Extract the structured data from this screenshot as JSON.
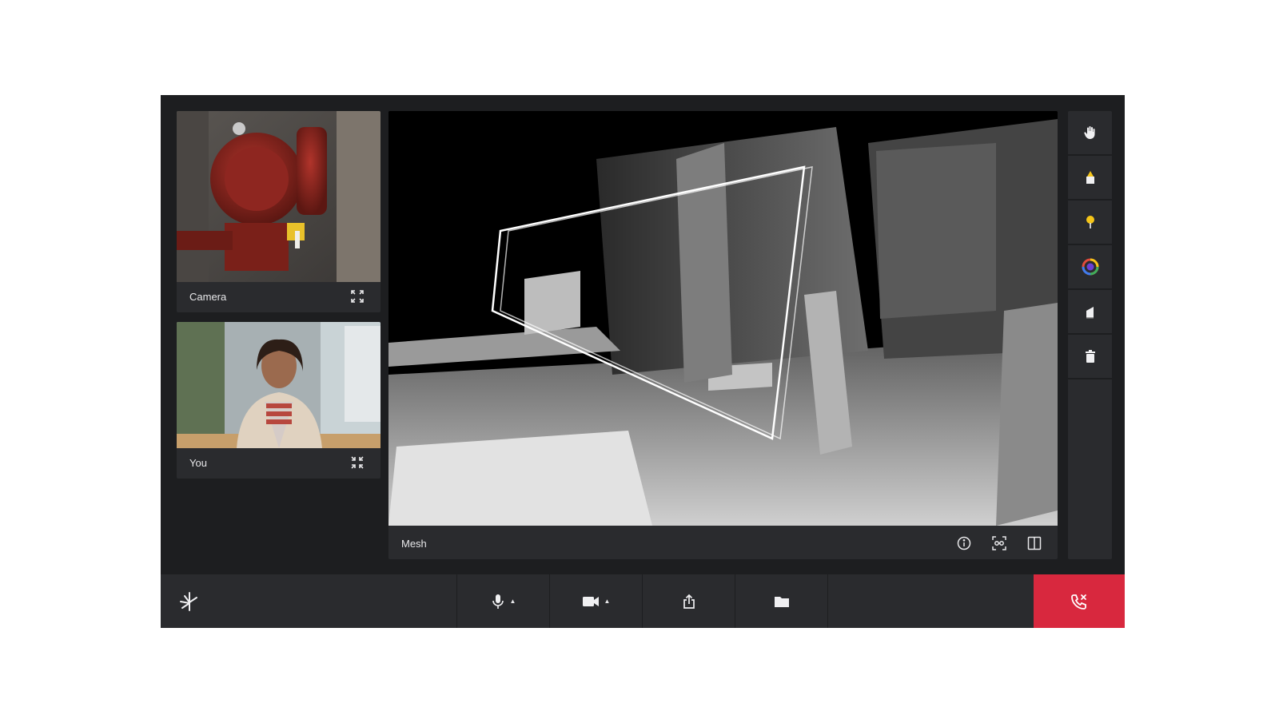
{
  "tiles": {
    "camera": {
      "label": "Camera"
    },
    "you": {
      "label": "You"
    },
    "mesh": {
      "label": "Mesh"
    }
  },
  "colors": {
    "end_call": "#d8283e",
    "background": "#1d1e20",
    "panel": "#2a2b2e",
    "accent_yellow": "#f5c518"
  },
  "tools": [
    {
      "name": "hand-icon"
    },
    {
      "name": "arrow-marker-icon"
    },
    {
      "name": "pin-icon"
    },
    {
      "name": "color-wheel-icon"
    },
    {
      "name": "eraser-icon"
    },
    {
      "name": "trash-icon"
    }
  ],
  "mesh_controls": [
    {
      "name": "info-icon"
    },
    {
      "name": "face-scan-icon"
    },
    {
      "name": "split-view-icon"
    }
  ],
  "bottom_bar": [
    {
      "name": "microphone-icon",
      "has_menu": true
    },
    {
      "name": "video-camera-icon",
      "has_menu": true
    },
    {
      "name": "share-icon",
      "has_menu": false
    },
    {
      "name": "folder-icon",
      "has_menu": false
    },
    {
      "name": "end-call-icon",
      "has_menu": false
    }
  ]
}
